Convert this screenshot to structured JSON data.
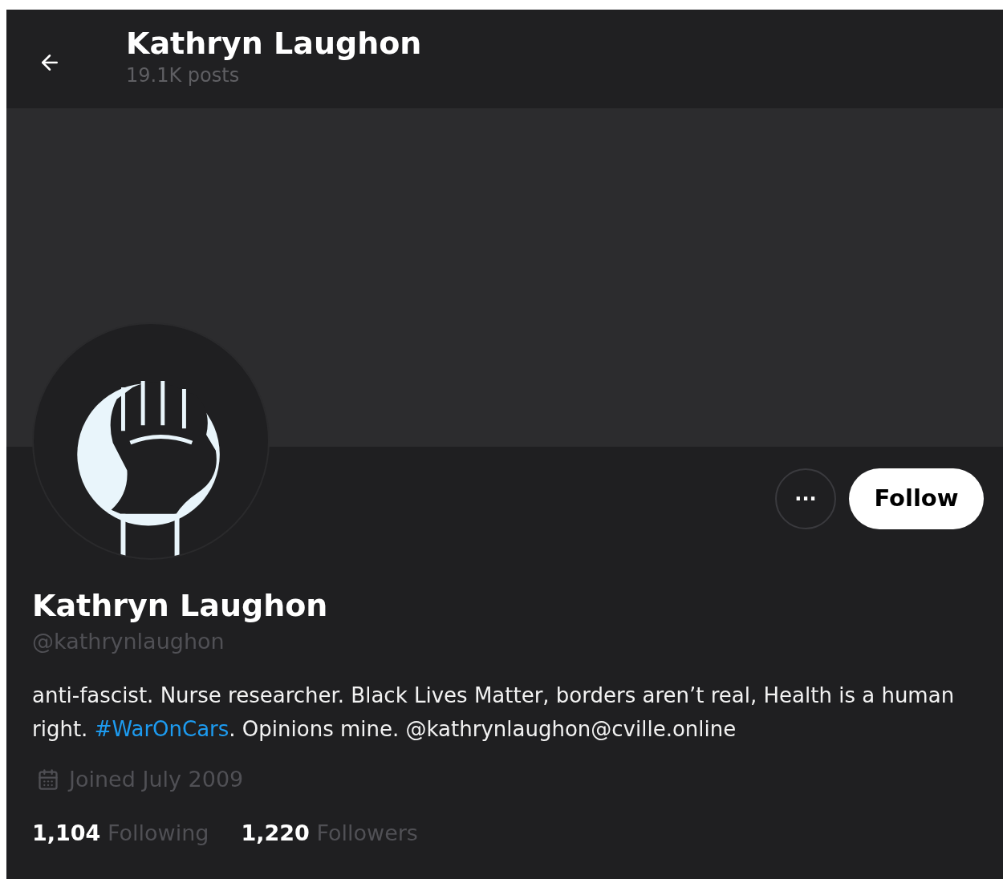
{
  "header": {
    "title": "Kathryn Laughon",
    "posts": "19.1K posts"
  },
  "profile": {
    "name": "Kathryn Laughon",
    "handle": "@kathrynlaughon",
    "bio": [
      {
        "kind": "text",
        "text": "anti-fascist. Nurse researcher. Black Lives Matter, borders aren’t real, Health is a human right. "
      },
      {
        "kind": "hashtag",
        "text": "#WarOnCars"
      },
      {
        "kind": "text",
        "text": ". Opinions mine. @kathrynlaughon@cville.online"
      }
    ],
    "joined": "Joined July 2009",
    "stats": [
      {
        "count": "1,104",
        "label": "Following"
      },
      {
        "count": "1,220",
        "label": "Followers"
      }
    ]
  },
  "actions": {
    "more": "···",
    "follow": "Follow"
  }
}
